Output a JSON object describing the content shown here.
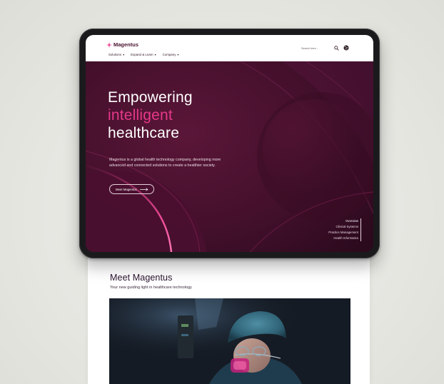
{
  "page": {
    "background": "#e9e9e5"
  },
  "brand": {
    "name": "Magentus",
    "accent": "#e6388a",
    "primary": "#4a1230"
  },
  "nav": {
    "items": [
      {
        "label": "Solutions"
      },
      {
        "label": "Expand & Learn"
      },
      {
        "label": "Company"
      }
    ],
    "search_placeholder": "Search here...",
    "search_icon": "search-icon",
    "globe_icon": "globe-icon"
  },
  "hero": {
    "title_line1": "Empowering",
    "title_line2": "intelligent",
    "title_line3": "healthcare",
    "description": "Magentus is a global health technology company, developing more advanced and connected solutions to create a healthier society.",
    "cta_label": "Meet Magentus",
    "cta_icon": "arrow-right-icon"
  },
  "side_nav": {
    "items": [
      {
        "label": "Overview"
      },
      {
        "label": "Clinical Systems"
      },
      {
        "label": "Practice Management"
      },
      {
        "label": "Health Informatics"
      }
    ]
  },
  "section": {
    "title": "Meet Magentus",
    "subtitle": "Your new guiding light in healthcare technology"
  }
}
